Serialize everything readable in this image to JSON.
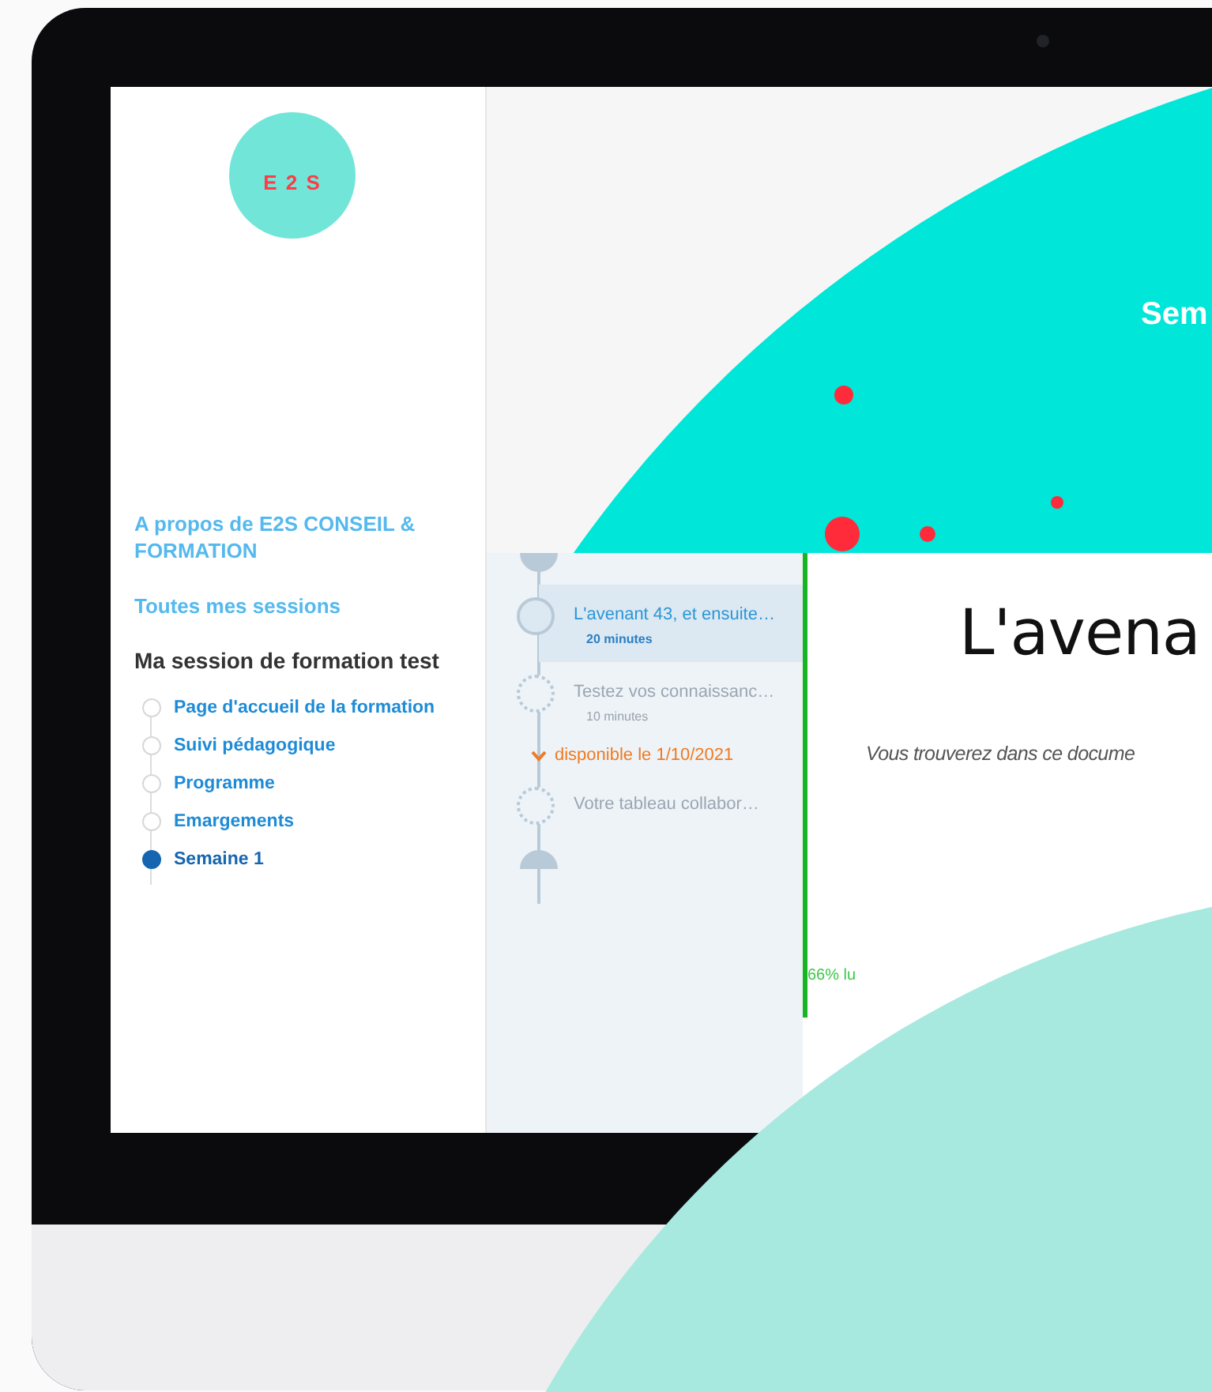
{
  "logo": {
    "text": "E 2 S"
  },
  "sidebar": {
    "links": [
      "A propos de  E2S CONSEIL & FORMATION",
      "Toutes mes sessions"
    ],
    "session_title": "Ma session de formation test",
    "items": [
      {
        "label": "Page d'accueil de la formation",
        "selected": false
      },
      {
        "label": "Suivi pédagogique",
        "selected": false
      },
      {
        "label": "Programme",
        "selected": false
      },
      {
        "label": "Emargements",
        "selected": false
      },
      {
        "label": "Semaine 1",
        "selected": true
      }
    ]
  },
  "hero": {
    "title": "Sem"
  },
  "timeline": {
    "items": [
      {
        "kind": "step",
        "title": "L'avenant 43, et ensuite…",
        "duration": "20 minutes",
        "selected": true,
        "locked": false
      },
      {
        "kind": "step",
        "title": "Testez vos connaissanc…",
        "duration": "10 minutes",
        "selected": false,
        "locked": true
      },
      {
        "kind": "notice",
        "text": "disponible le 1/10/2021"
      },
      {
        "kind": "step",
        "title": "Votre tableau collabor…",
        "selected": false,
        "locked": true
      }
    ]
  },
  "document": {
    "title": "L'avena",
    "intro": "Vous trouverez dans ce docume",
    "progress": {
      "level": 0.8,
      "label": "66% lu"
    }
  }
}
